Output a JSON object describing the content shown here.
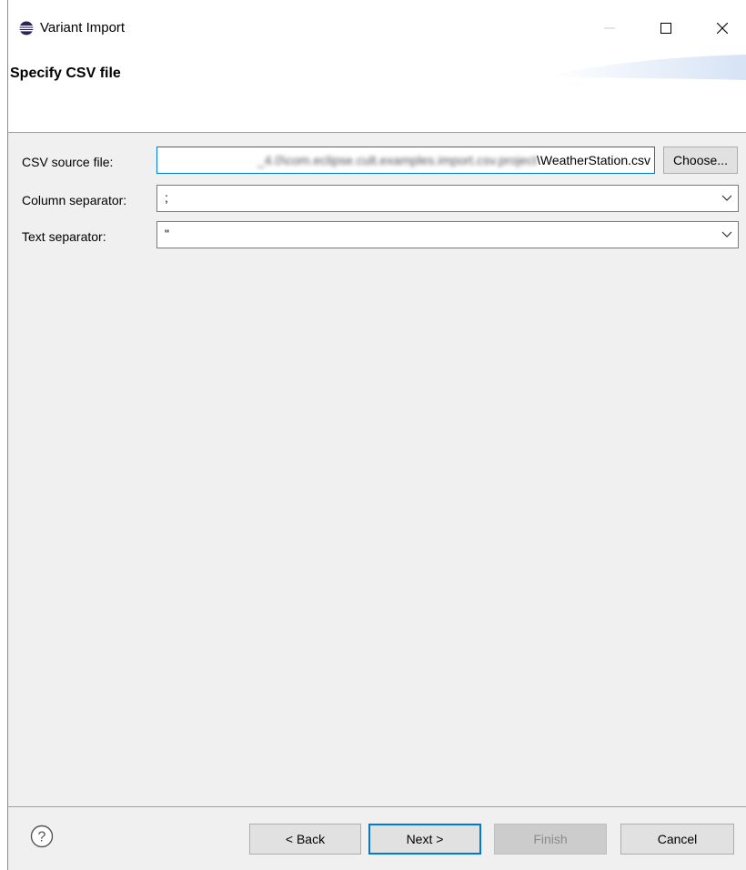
{
  "window": {
    "title": "Variant Import",
    "icon": "eclipse-icon"
  },
  "banner": {
    "title": "Specify CSV file"
  },
  "form": {
    "csv_source_file": {
      "label": "CSV source file:",
      "value_blurred": "_4.0\\com.eclipse.cult.examples.import.csv.project",
      "value_visible": "\\WeatherStation.csv",
      "button_label": "Choose..."
    },
    "column_separator": {
      "label": "Column separator:",
      "value": ";"
    },
    "text_separator": {
      "label": "Text separator:",
      "value": "\""
    }
  },
  "footer": {
    "help_icon": "help-icon",
    "back_label": "< Back",
    "next_label": "Next >",
    "finish_label": "Finish",
    "cancel_label": "Cancel"
  },
  "colors": {
    "accent": "#0078d7",
    "dialog_bg": "#f0f0f0",
    "button_bg": "#e1e1e1"
  }
}
